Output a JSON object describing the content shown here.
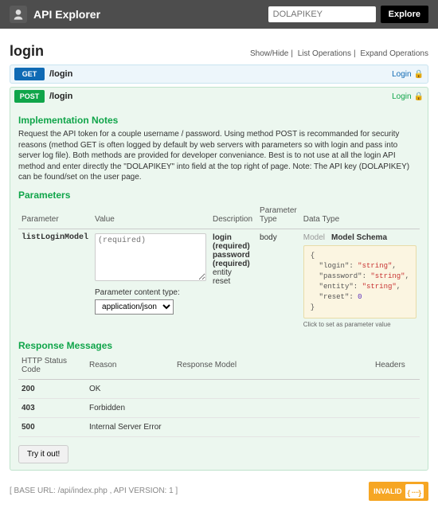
{
  "header": {
    "title": "API Explorer",
    "apikey_placeholder": "DOLAPIKEY",
    "explore_label": "Explore"
  },
  "section": {
    "title": "login",
    "links": {
      "showhide": "Show/Hide",
      "listops": "List Operations",
      "expandops": "Expand Operations"
    }
  },
  "endpoints": {
    "get": {
      "method": "GET",
      "path": "/login",
      "action": "Login"
    },
    "post": {
      "method": "POST",
      "path": "/login",
      "action": "Login"
    }
  },
  "impl": {
    "heading": "Implementation Notes",
    "text": "Request the API token for a couple username / password. Using method POST is recommanded for security reasons (method GET is often logged by default by web servers with parameters so with login and pass into server log file). Both methods are provided for developer conveniance. Best is to not use at all the login API method and enter directly the \"DOLAPIKEY\" into field at the top right of page. Note: The API key (DOLAPIKEY) can be found/set on the user page."
  },
  "params": {
    "heading": "Parameters",
    "cols": {
      "parameter": "Parameter",
      "value": "Value",
      "description": "Description",
      "ptype": "Parameter Type",
      "dtype": "Data Type"
    },
    "row": {
      "name": "listLoginModel",
      "value_placeholder": "(required)",
      "desc": {
        "login": "login (required)",
        "password": "password (required)",
        "entity": "entity",
        "reset": "reset"
      },
      "ptype": "body",
      "model_tab": "Model",
      "schema_tab": "Model Schema"
    },
    "content_type": {
      "label": "Parameter content type:",
      "value": "application/json"
    },
    "schema": {
      "login_k": "\"login\"",
      "password_k": "\"password\"",
      "entity_k": "\"entity\"",
      "reset_k": "\"reset\"",
      "str": "\"string\"",
      "zero": "0"
    },
    "schema_note": "Click to set as parameter value"
  },
  "responses": {
    "heading": "Response Messages",
    "cols": {
      "code": "HTTP Status Code",
      "reason": "Reason",
      "model": "Response Model",
      "headers": "Headers"
    },
    "rows": [
      {
        "code": "200",
        "reason": "OK"
      },
      {
        "code": "403",
        "reason": "Forbidden"
      },
      {
        "code": "500",
        "reason": "Internal Server Error"
      }
    ]
  },
  "try_label": "Try it out!",
  "footer": {
    "text": "[ BASE URL: /api/index.php , API VERSION: 1 ]",
    "invalid": "INVALID",
    "bracket": "{᠁}"
  }
}
